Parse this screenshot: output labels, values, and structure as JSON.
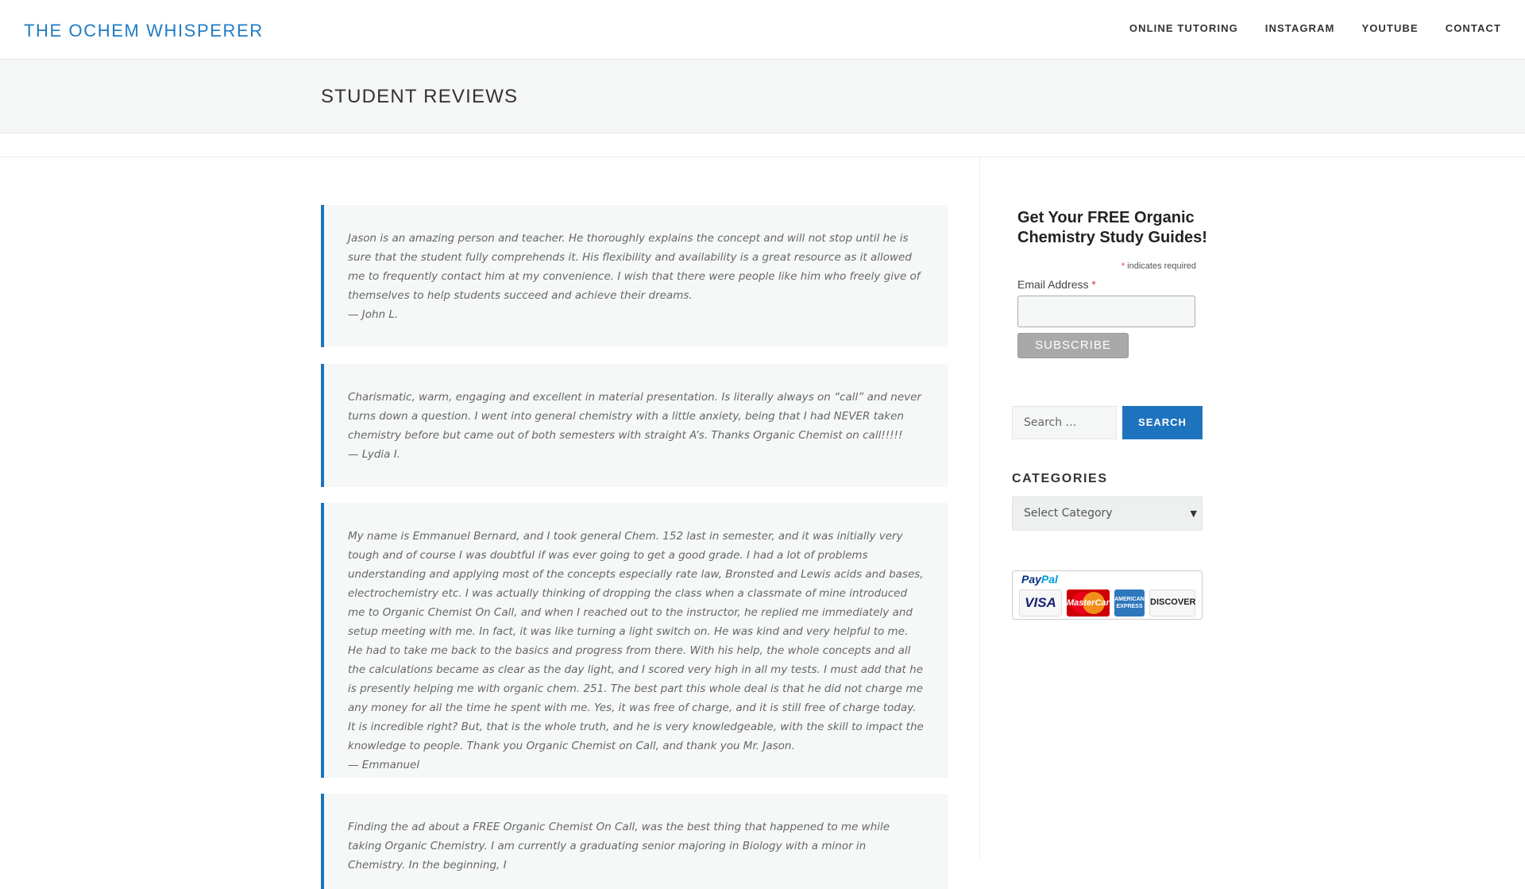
{
  "header": {
    "site_title": "THE OCHEM WHISPERER",
    "nav": [
      "ONLINE TUTORING",
      "INSTAGRAM",
      "YOUTUBE",
      "CONTACT"
    ]
  },
  "page": {
    "title": "STUDENT REVIEWS"
  },
  "reviews": [
    {
      "text": "Jason is an amazing person and teacher. He thoroughly explains the concept and will not stop until he is sure that the student fully comprehends it. His flexibility and availability is a great resource as it allowed me to frequently contact him at my convenience. I wish that there were people like him who freely give of themselves to help students succeed and achieve their dreams.",
      "author": "— John L."
    },
    {
      "text": "Charismatic, warm, engaging and excellent in material presentation. Is literally always on “call” and never turns down a question. I went into general chemistry with  a little anxiety, being that I had NEVER taken chemistry before but came out of both semesters with straight A’s. Thanks Organic Chemist on call!!!!!",
      "author": "— Lydia I."
    },
    {
      "text": "My name is Emmanuel Bernard, and I took general Chem. 152 last in semester, and it was initially very tough and of course I was  doubtful if was ever going to get a good grade. I had a lot of problems understanding and applying most of the concepts especially rate law, Bronsted and Lewis acids and bases, electrochemistry etc. I was actually thinking of dropping the class when a classmate of mine introduced me  to Organic Chemist On Call,  and when I reached out to the  instructor, he replied me immediately and  setup meeting  with me. In fact, it was like turning a light switch on. He was kind and very helpful to me. He had to take me back to the basics and progress from there. With his help, the whole concepts and all the calculations became as clear as the day light, and I scored very high in all my tests. I must add that he is presently helping me with organic chem. 251. The best part this whole deal is that he did not charge me any money for all the time he spent with me. Yes, it was free of charge, and it is still free of charge today.  It is incredible right?  But, that is the whole truth, and he is very knowledgeable, with the skill to impact the knowledge to people. Thank you Organic Chemist on Call, and thank you Mr. Jason.",
      "author": "— Emmanuel"
    },
    {
      "text": "Finding the ad about a FREE Organic Chemist On Call, was the best thing that happened to me while taking Organic Chemistry. I am currently a graduating senior majoring in Biology with a minor in Chemistry. In the beginning, I",
      "author": ""
    }
  ],
  "sidebar": {
    "mailchimp": {
      "title": "Get Your FREE Organic Chemistry Study Guides!",
      "asterisk": "*",
      "indicates_required": "indicates required",
      "email_label": "Email Address",
      "subscribe_label": "Subscribe"
    },
    "search": {
      "placeholder": "Search …",
      "button_label": "Search"
    },
    "categories": {
      "title": "CATEGORIES",
      "selected": "Select Category"
    },
    "paypal": {
      "logo_text_1": "Pay",
      "logo_text_2": "Pal",
      "cards": [
        "VISA",
        "MasterCard",
        "AMERICAN EXPRESS",
        "DISCOVER"
      ]
    }
  },
  "colors": {
    "accent": "#1e73be",
    "title_blue": "#1f7bc4",
    "band_bg": "#f5f7f7"
  }
}
